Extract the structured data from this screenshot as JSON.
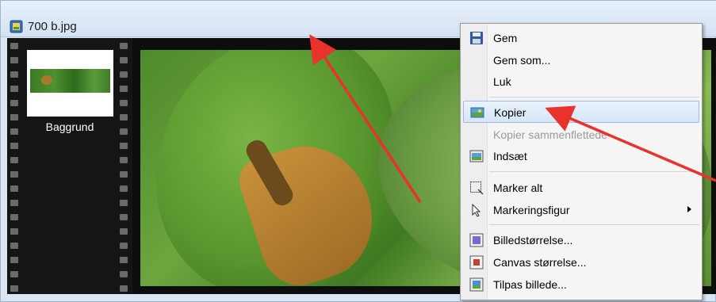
{
  "window": {
    "title": "700 b.jpg",
    "icon": "image-file-icon"
  },
  "filmstrip": {
    "layer_label": "Baggrund"
  },
  "context_menu": {
    "items": [
      {
        "label": "Gem",
        "icon": "save-icon",
        "enabled": true
      },
      {
        "label": "Gem som...",
        "icon": "",
        "enabled": true
      },
      {
        "label": "Luk",
        "icon": "",
        "enabled": true
      },
      {
        "label": "Kopier",
        "icon": "copy-image-icon",
        "enabled": true,
        "highlighted": true
      },
      {
        "label": "Kopier sammenflettede",
        "icon": "",
        "enabled": false
      },
      {
        "label": "Indsæt",
        "icon": "paste-image-icon",
        "enabled": true
      },
      {
        "label": "Marker alt",
        "icon": "select-all-icon",
        "enabled": true
      },
      {
        "label": "Markeringsfigur",
        "icon": "cursor-icon",
        "enabled": true,
        "has_submenu": true
      },
      {
        "label": "Billedstørrelse...",
        "icon": "image-size-icon",
        "enabled": true
      },
      {
        "label": "Canvas størrelse...",
        "icon": "canvas-size-icon",
        "enabled": true
      },
      {
        "label": "Tilpas billede...",
        "icon": "fit-image-icon",
        "enabled": true
      }
    ]
  },
  "colors": {
    "annotation_arrow": "#e8322b",
    "menu_highlight": "#d6e6f8"
  }
}
